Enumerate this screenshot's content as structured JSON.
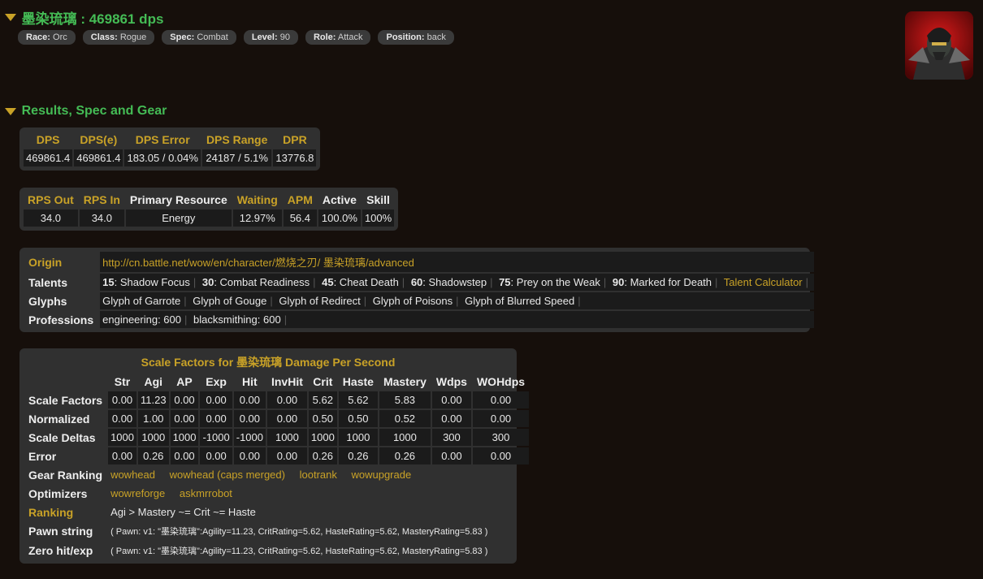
{
  "player": {
    "title": "墨染琉璃 : 469861 dps",
    "params": [
      {
        "label": "Race:",
        "value": "Orc"
      },
      {
        "label": "Class:",
        "value": "Rogue"
      },
      {
        "label": "Spec:",
        "value": "Combat"
      },
      {
        "label": "Level:",
        "value": "90"
      },
      {
        "label": "Role:",
        "value": "Attack"
      },
      {
        "label": "Position:",
        "value": "back"
      }
    ]
  },
  "section_title": "Results, Spec and Gear",
  "dps_table": {
    "headers": [
      "DPS",
      "DPS(e)",
      "DPS Error",
      "DPS Range",
      "DPR"
    ],
    "values": [
      "469861.4",
      "469861.4",
      "183.05 / 0.04%",
      "24187 / 5.1%",
      "13776.8"
    ]
  },
  "resource_table": {
    "headers": [
      "RPS Out",
      "RPS In",
      "Primary Resource",
      "Waiting",
      "APM",
      "Active",
      "Skill"
    ],
    "values": [
      "34.0",
      "34.0",
      "Energy",
      "12.97%",
      "56.4",
      "100.0%",
      "100%"
    ]
  },
  "character": {
    "origin_label": "Origin",
    "origin_url": "http://cn.battle.net/wow/en/character/燃烧之刃/ 墨染琉璃/advanced",
    "talents_label": "Talents",
    "talents": [
      {
        "level": "15",
        "name": ": Shadow Focus"
      },
      {
        "level": "30",
        "name": ": Combat Readiness"
      },
      {
        "level": "45",
        "name": ": Cheat Death"
      },
      {
        "level": "60",
        "name": ": Shadowstep"
      },
      {
        "level": "75",
        "name": ": Prey on the Weak"
      },
      {
        "level": "90",
        "name": ": Marked for Death"
      }
    ],
    "talent_calc": "Talent Calculator",
    "glyphs_label": "Glyphs",
    "glyphs": [
      "Glyph of Garrote",
      "Glyph of Gouge",
      "Glyph of Redirect",
      "Glyph of Poisons",
      "Glyph of Blurred Speed"
    ],
    "professions_label": "Professions",
    "professions": [
      "engineering: 600",
      "blacksmithing: 600"
    ]
  },
  "scale": {
    "caption": "Scale Factors for 墨染琉璃 Damage Per Second",
    "columns": [
      "Str",
      "Agi",
      "AP",
      "Exp",
      "Hit",
      "InvHit",
      "Crit",
      "Haste",
      "Mastery",
      "Wdps",
      "WOHdps"
    ],
    "rows": [
      {
        "label": "Scale Factors",
        "values": [
          "0.00",
          "11.23",
          "0.00",
          "0.00",
          "0.00",
          "0.00",
          "5.62",
          "5.62",
          "5.83",
          "0.00",
          "0.00"
        ]
      },
      {
        "label": "Normalized",
        "values": [
          "0.00",
          "1.00",
          "0.00",
          "0.00",
          "0.00",
          "0.00",
          "0.50",
          "0.50",
          "0.52",
          "0.00",
          "0.00"
        ]
      },
      {
        "label": "Scale Deltas",
        "values": [
          "1000",
          "1000",
          "1000",
          "-1000",
          "-1000",
          "1000",
          "1000",
          "1000",
          "1000",
          "300",
          "300"
        ]
      },
      {
        "label": "Error",
        "values": [
          "0.00",
          "0.26",
          "0.00",
          "0.00",
          "0.00",
          "0.00",
          "0.26",
          "0.26",
          "0.26",
          "0.00",
          "0.00"
        ]
      }
    ],
    "gear_ranking_label": "Gear Ranking",
    "gear_ranking_links": [
      "wowhead",
      "wowhead (caps merged)",
      "lootrank",
      "wowupgrade"
    ],
    "optimizers_label": "Optimizers",
    "optimizer_links": [
      "wowreforge",
      "askmrrobot"
    ],
    "ranking_label": "Ranking",
    "ranking_value": "Agi > Mastery ~= Crit ~= Haste",
    "pawn_label": "Pawn string",
    "pawn_value": "( Pawn: v1: \"墨染琉璃\":Agility=11.23, CritRating=5.62, HasteRating=5.62, MasteryRating=5.83 )",
    "zero_hit_label": "Zero hit/exp",
    "zero_hit_value": "( Pawn: v1: \"墨染琉璃\":Agility=11.23, CritRating=5.62, HasteRating=5.62, MasteryRating=5.83 )"
  },
  "icons": {
    "toggle": "triangle-down-icon",
    "avatar": "character-portrait"
  },
  "colors": {
    "background": "#160f0b",
    "title_green": "#44bb55",
    "gold": "#c9a227",
    "panel": "#303030",
    "cell": "#1b1b1b"
  }
}
